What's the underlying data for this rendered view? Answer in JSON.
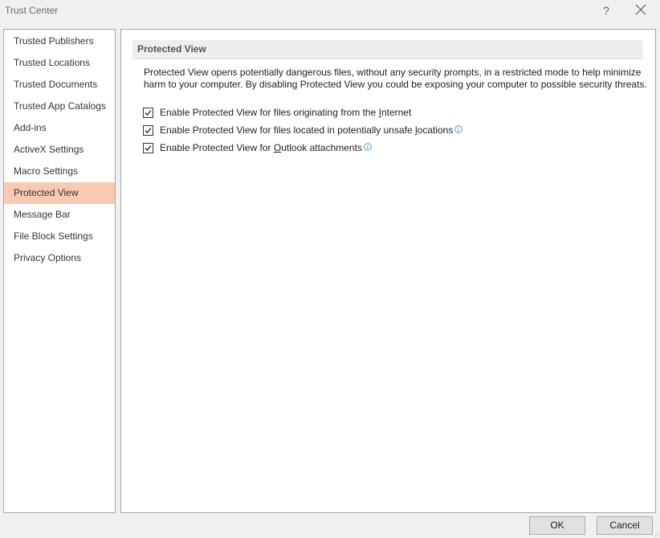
{
  "window": {
    "title": "Trust Center",
    "help_label": "?"
  },
  "sidebar": {
    "items": [
      {
        "label": "Trusted Publishers",
        "selected": false
      },
      {
        "label": "Trusted Locations",
        "selected": false
      },
      {
        "label": "Trusted Documents",
        "selected": false
      },
      {
        "label": "Trusted App Catalogs",
        "selected": false
      },
      {
        "label": "Add-ins",
        "selected": false
      },
      {
        "label": "ActiveX Settings",
        "selected": false
      },
      {
        "label": "Macro Settings",
        "selected": false
      },
      {
        "label": "Protected View",
        "selected": true
      },
      {
        "label": "Message Bar",
        "selected": false
      },
      {
        "label": "File Block Settings",
        "selected": false
      },
      {
        "label": "Privacy Options",
        "selected": false
      }
    ],
    "selected_color": "#f9c9b0"
  },
  "main": {
    "section_title": "Protected View",
    "description": "Protected View opens potentially dangerous files, without any security prompts, in a restricted mode to help minimize harm to your computer. By disabling Protected View you could be exposing your computer to possible security threats.",
    "options": [
      {
        "pre": "Enable Protected View for files originating from the ",
        "accel": "I",
        "post": "nternet",
        "checked": true,
        "info": false
      },
      {
        "pre": "Enable Protected View for files located in potentially unsafe ",
        "accel": "l",
        "post": "ocations",
        "checked": true,
        "info": true
      },
      {
        "pre": "Enable Protected View for ",
        "accel": "O",
        "post": "utlook attachments",
        "checked": true,
        "info": true
      }
    ]
  },
  "footer": {
    "ok_label": "OK",
    "cancel_label": "Cancel"
  },
  "colors": {
    "info_icon": "#3c8ed1"
  }
}
